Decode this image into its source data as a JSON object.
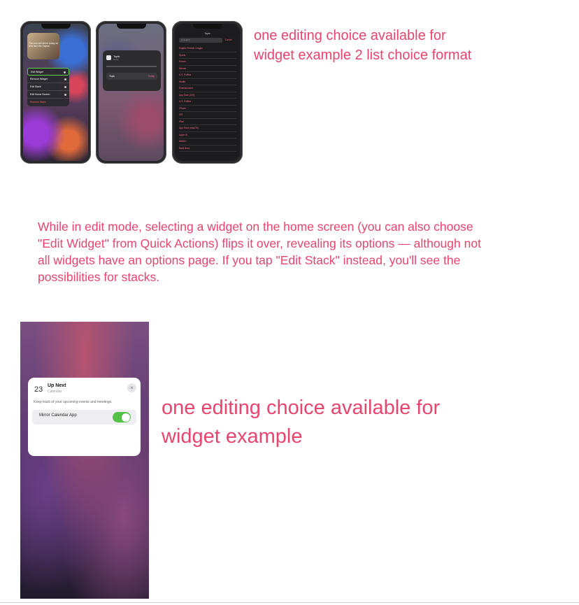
{
  "captions": {
    "top": "one editing choice available for widget example 2 list choice format",
    "paragraph": "While in edit mode, selecting a widget on the home screen (you can also choose \"Edit Widget\" from Quick Actions) flips it over, revealing its options — although not all widgets have an options page. If you tap \"Edit Stack\" instead, you'll see the possibilities for stacks.",
    "bottom": "one editing choice available for widget example"
  },
  "phone1": {
    "album_text": "The sun will shine today so let's feel the rhythm",
    "menu": [
      {
        "label": "Edit Widget",
        "active": true
      },
      {
        "label": "Remove Widget",
        "active": false
      },
      {
        "label": "Edit Stack",
        "active": false
      },
      {
        "label": "Edit Home Screen",
        "active": false
      },
      {
        "label": "Remove Stack",
        "active": false,
        "danger": true
      }
    ]
  },
  "phone2": {
    "title": "Topic",
    "subtitle": "News",
    "row_label": "Topic",
    "row_value": "Today"
  },
  "phone3": {
    "header": "Topic",
    "search_placeholder": "Q Search",
    "cancel": "Cancel",
    "items": [
      "English Premier League",
      "Sports",
      "Soccer",
      "Movies",
      "U.S. Politics",
      "Health",
      "Entertainment",
      "App Store (iOS)",
      "U.S. Politics",
      "iPhone",
      "iOS",
      "iPad",
      "App Store (macOS)",
      "Apple ID",
      "WWDC",
      "Bank Buzz"
    ]
  },
  "widget": {
    "date_number": "23",
    "title": "Up Next",
    "subtitle": "Calendar",
    "description": "Keep track of your upcoming events and meetings.",
    "option_label": "Mirror Calendar App",
    "option_enabled": true,
    "close_glyph": "×"
  },
  "colors": {
    "caption_pink": "#e8456e",
    "toggle_green": "#55c148"
  }
}
